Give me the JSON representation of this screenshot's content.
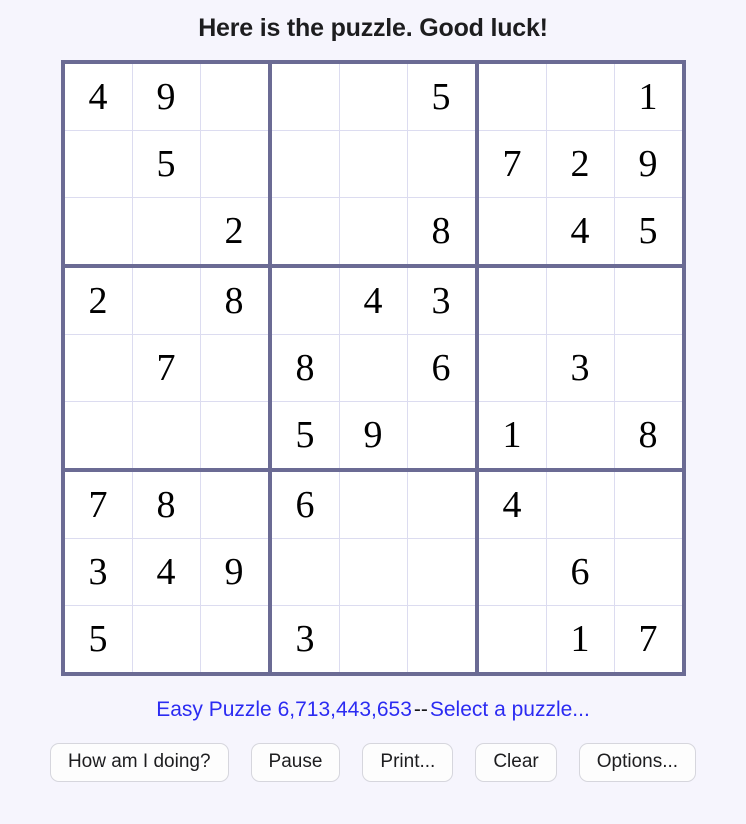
{
  "header": {
    "title": "Here is the puzzle. Good luck!"
  },
  "puzzle": {
    "grid": [
      [
        "4",
        "9",
        "",
        "",
        "",
        "5",
        "",
        "",
        "1"
      ],
      [
        "",
        "5",
        "",
        "",
        "",
        "",
        "7",
        "2",
        "9"
      ],
      [
        "",
        "",
        "2",
        "",
        "",
        "8",
        "",
        "4",
        "5"
      ],
      [
        "2",
        "",
        "8",
        "",
        "4",
        "3",
        "",
        "",
        ""
      ],
      [
        "",
        "7",
        "",
        "8",
        "",
        "6",
        "",
        "3",
        ""
      ],
      [
        "",
        "",
        "",
        "5",
        "9",
        "",
        "1",
        "",
        "8"
      ],
      [
        "7",
        "8",
        "",
        "6",
        "",
        "",
        "4",
        "",
        ""
      ],
      [
        "3",
        "4",
        "9",
        "",
        "",
        "",
        "",
        "6",
        ""
      ],
      [
        "5",
        "",
        "",
        "3",
        "",
        "",
        "",
        "1",
        "7"
      ]
    ]
  },
  "status": {
    "puzzle_link": "Easy Puzzle 6,713,443,653",
    "separator": "--",
    "select_link": "Select a puzzle..."
  },
  "toolbar": {
    "buttons": [
      {
        "name": "how-am-i-doing-button",
        "label": "How am I doing?"
      },
      {
        "name": "pause-button",
        "label": "Pause"
      },
      {
        "name": "print-button",
        "label": "Print..."
      },
      {
        "name": "clear-button",
        "label": "Clear"
      },
      {
        "name": "options-button",
        "label": "Options..."
      }
    ]
  },
  "colors": {
    "page_background": "#f6f5fd",
    "grid_thick_line": "#6b6b94",
    "grid_thin_line": "#dcdcf0",
    "cell_background": "#ffffff",
    "digit": "#000000",
    "link": "#2b2bf2",
    "title_text": "#1d1d1f"
  }
}
